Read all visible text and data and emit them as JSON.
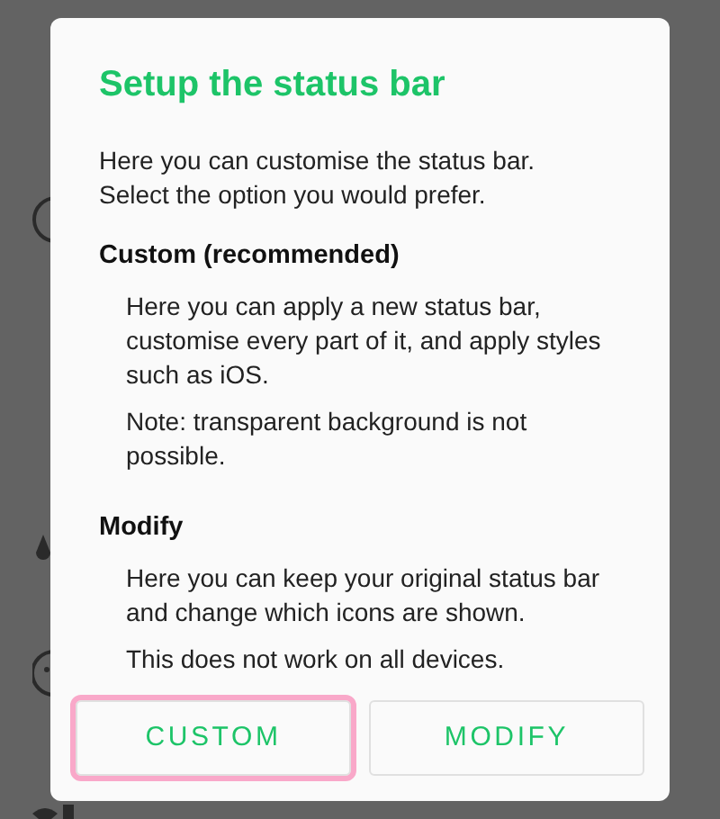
{
  "dialog": {
    "title": "Setup the status bar",
    "intro": "Here you can customise the status bar. Select the option you would prefer.",
    "sections": [
      {
        "heading": "Custom (recommended)",
        "paragraphs": [
          "Here you can apply a new status bar, customise every part of it, and apply styles such as iOS.",
          "Note: transparent background is not possible."
        ]
      },
      {
        "heading": "Modify",
        "paragraphs": [
          "Here you can keep your original status bar and change which icons are shown.",
          "This does not work on all devices."
        ]
      }
    ],
    "buttons": [
      {
        "label": "CUSTOM",
        "focused": true
      },
      {
        "label": "MODIFY",
        "focused": false
      }
    ]
  }
}
